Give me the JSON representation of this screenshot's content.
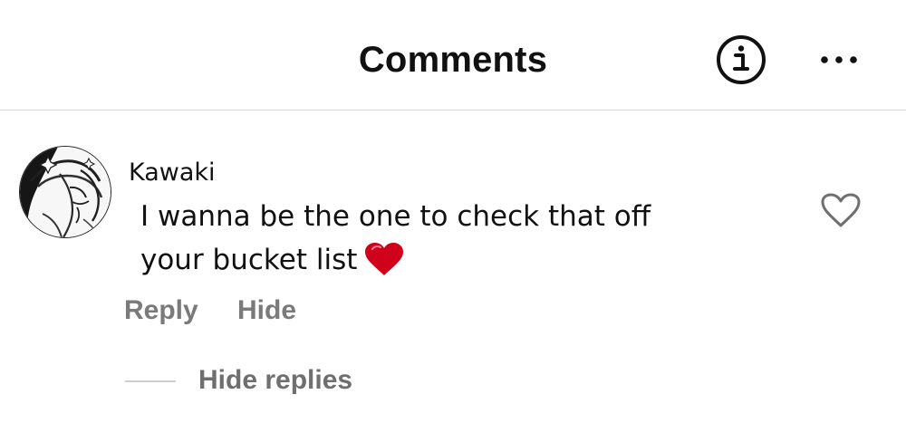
{
  "header": {
    "title": "Comments",
    "info_icon": "info-circle-icon",
    "more_icon": "more-horizontal-icon"
  },
  "comment": {
    "username": "Kawaki",
    "text": "I wanna be the one to check that off your bucket list",
    "emoji": "red-heart-emoji",
    "like_icon": "heart-outline-icon",
    "reply_label": "Reply",
    "hide_label": "Hide",
    "hide_replies_label": "Hide replies"
  },
  "colors": {
    "action_text": "#7a7a7a",
    "heart_emoji": "#d0021b",
    "divider": "#d6d6d6"
  }
}
